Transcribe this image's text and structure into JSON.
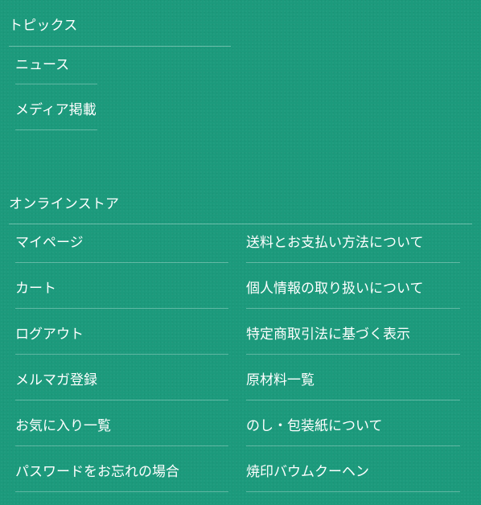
{
  "topics": {
    "title": "トピックス",
    "links": [
      "ニュース",
      "メディア掲載"
    ]
  },
  "store": {
    "title": "オンラインストア",
    "left_links": [
      "マイページ",
      "カート",
      "ログアウト",
      "メルマガ登録",
      "お気に入り一覧",
      "パスワードをお忘れの場合"
    ],
    "right_links": [
      "送料とお支払い方法について",
      "個人情報の取り扱いについて",
      "特定商取引法に基づく表示",
      "原材料一覧",
      "のし・包装紙について",
      "焼印バウムクーヘン"
    ]
  }
}
